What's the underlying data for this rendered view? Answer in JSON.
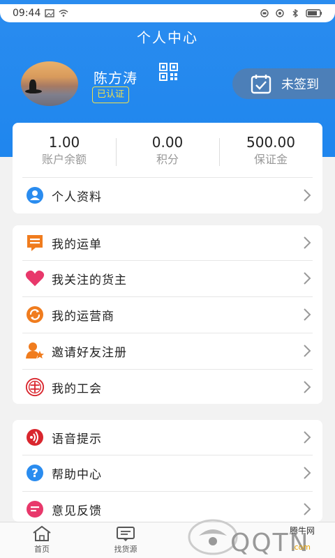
{
  "status_bar": {
    "time": "09:44"
  },
  "header": {
    "title": "个人中心"
  },
  "user": {
    "name": "陈方涛",
    "badge": "已认证"
  },
  "signin": {
    "label": "未签到"
  },
  "stats": [
    {
      "value": "1.00",
      "label": "账户余额"
    },
    {
      "value": "0.00",
      "label": "积分"
    },
    {
      "value": "500.00",
      "label": "保证金"
    }
  ],
  "profile_row": {
    "label": "个人资料"
  },
  "menu_group_1": [
    {
      "label": "我的运单",
      "icon": "waybill-icon",
      "color": "#f07c1e"
    },
    {
      "label": "我关注的货主",
      "icon": "heart-icon",
      "color": "#e8386b"
    },
    {
      "label": "我的运营商",
      "icon": "operator-icon",
      "color": "#f07c1e"
    },
    {
      "label": "邀请好友注册",
      "icon": "invite-friend-icon",
      "color": "#f07c1e"
    },
    {
      "label": "我的工会",
      "icon": "union-icon",
      "color": "#d9262e"
    }
  ],
  "menu_group_2": [
    {
      "label": "语音提示",
      "icon": "voice-icon",
      "color": "#d9262e"
    },
    {
      "label": "帮助中心",
      "icon": "help-icon",
      "color": "#2a8cef"
    },
    {
      "label": "意见反馈",
      "icon": "feedback-icon",
      "color": "#e8386b"
    }
  ],
  "bottom_nav": [
    {
      "label": "首页",
      "icon": "home-icon"
    },
    {
      "label": "找货源",
      "icon": "find-goods-icon"
    }
  ],
  "watermark": {
    "brand": "QQTN",
    "site": "腾牛网",
    "domain": ".com"
  },
  "colors": {
    "primary": "#2a8cef",
    "badge": "#f2e14a",
    "signin_bg": "#4c7fb8"
  }
}
